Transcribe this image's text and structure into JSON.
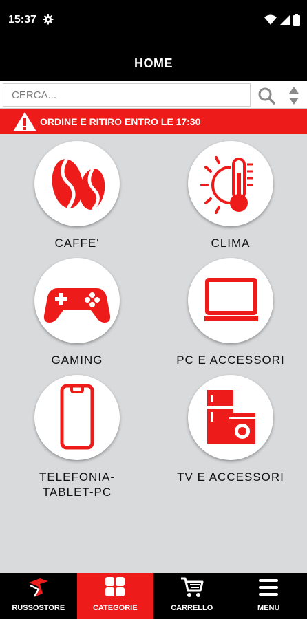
{
  "status_bar": {
    "time": "15:37"
  },
  "header": {
    "title": "HOME"
  },
  "search": {
    "placeholder": "CERCA..."
  },
  "banner": {
    "text": "ORDINE E RITIRO ENTRO LE 17:30"
  },
  "categories": [
    {
      "label": "CAFFE'",
      "icon": "coffee-bean-icon"
    },
    {
      "label": "CLIMA",
      "icon": "thermometer-sun-icon"
    },
    {
      "label": "GAMING",
      "icon": "gamepad-icon"
    },
    {
      "label": "PC E ACCESSORI",
      "icon": "laptop-icon"
    },
    {
      "label": "TELEFONIA-\nTABLET-PC",
      "icon": "smartphone-icon"
    },
    {
      "label": "TV E ACCESSORI",
      "icon": "appliances-icon"
    }
  ],
  "bottom_nav": {
    "items": [
      {
        "label": "RUSSOSTORE",
        "icon": "russostore-logo-icon",
        "active": false
      },
      {
        "label": "CATEGORIE",
        "icon": "categories-grid-icon",
        "active": true
      },
      {
        "label": "CARRELLO",
        "icon": "cart-icon",
        "active": false
      },
      {
        "label": "MENU",
        "icon": "hamburger-menu-icon",
        "active": false
      }
    ]
  },
  "colors": {
    "accent": "#ee1b1b",
    "bar": "#000000",
    "background": "#d9dadc"
  }
}
